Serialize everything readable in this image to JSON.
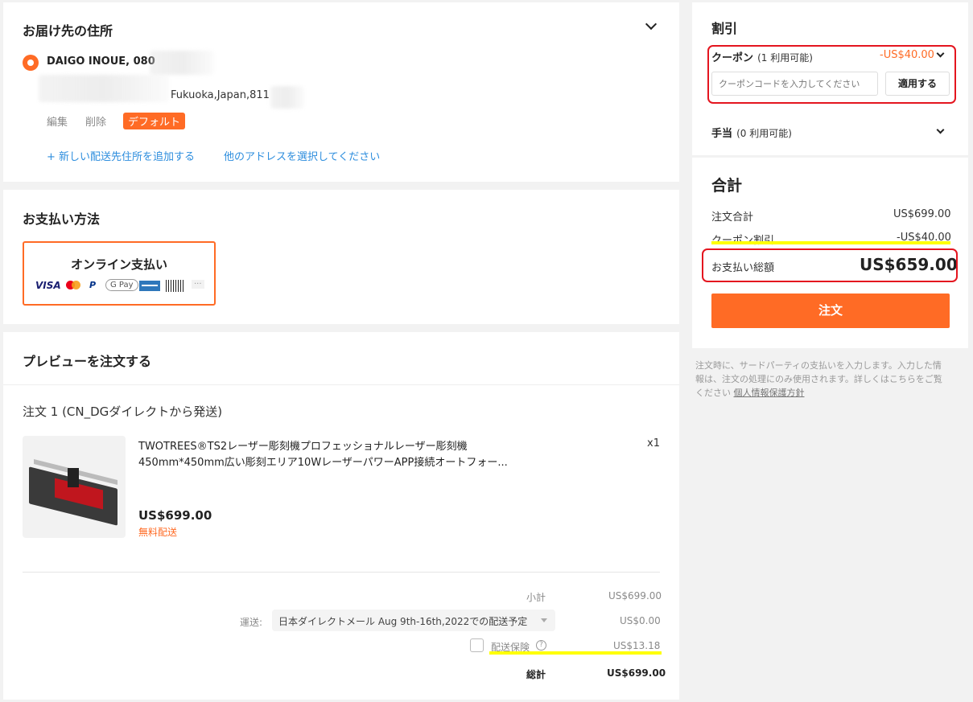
{
  "address": {
    "section_title": "お届け先の住所",
    "name_line": "DAIGO INOUE, 080",
    "address_line": "Fukuoka,Japan,811",
    "edit_label": "編集",
    "delete_label": "削除",
    "default_badge": "デフォルト",
    "add_address_link": "+ 新しい配送先住所を追加する",
    "select_other_link": "他のアドレスを選択してください"
  },
  "payment": {
    "section_title": "お支払い方法",
    "option_label": "オンライン支払い",
    "icons": [
      "visa-icon",
      "mastercard-icon",
      "paypal-icon",
      "google-pay-icon",
      "amex-icon",
      "boleto-icon",
      "more-icon"
    ],
    "visa_text": "VISA",
    "gpay_text": "G Pay",
    "more_text": "···"
  },
  "preview": {
    "section_title": "プレビューを注文する",
    "order_label": "注文 1 (CN_DGダイレクトから発送)",
    "product": {
      "title_line1": "TWOTREES®TS2レーザー彫刻機プロフェッショナルレーザー彫刻機",
      "title_line2": "450mm*450mm広い彫刻エリア10Wレーザーパワー​APP接続オートフォー...",
      "quantity": "x1",
      "price": "US$699.00",
      "shipping_note": "無料配送"
    },
    "subtotal_label": "小計",
    "subtotal_value": "US$699.00",
    "shipping_label": "運送:",
    "shipping_option": "日本ダイレクトメール Aug 9th-16th,2022での配送予定",
    "shipping_value": "US$0.00",
    "insurance_label": "配送保険",
    "insurance_value": "US$13.18",
    "total_label": "総計",
    "total_value": "US$699.00"
  },
  "discount": {
    "section_title": "割引",
    "coupon_label": "クーポン",
    "coupon_available": "(1 利用可能)",
    "coupon_amount": "-US$40.00",
    "coupon_placeholder": "クーポンコードを入力してください",
    "apply_button": "適用する",
    "allowance_label": "手当",
    "allowance_available": "(0 利用可能)"
  },
  "summary": {
    "section_title": "合計",
    "order_total_label": "注文合計",
    "order_total_value": "US$699.00",
    "coupon_discount_label": "クーポン割引",
    "coupon_discount_value": "-US$40.00",
    "payment_total_label": "お支払い総額",
    "payment_total_value": "US$659.00",
    "order_button": "注文"
  },
  "notice": {
    "line1": "注文時に、サードパーティの支払いを入力します。入力した情",
    "line2": "報は、注文の処理にのみ使用されます。詳しくはこちらをご覧",
    "line3": "ください ",
    "privacy_link": "個人情報保護方針"
  },
  "colors": {
    "accent_orange": "#ff6b25",
    "annotation_red": "#e4151f",
    "annotation_yellow": "#ffff00",
    "link_blue": "#2e8ede"
  }
}
